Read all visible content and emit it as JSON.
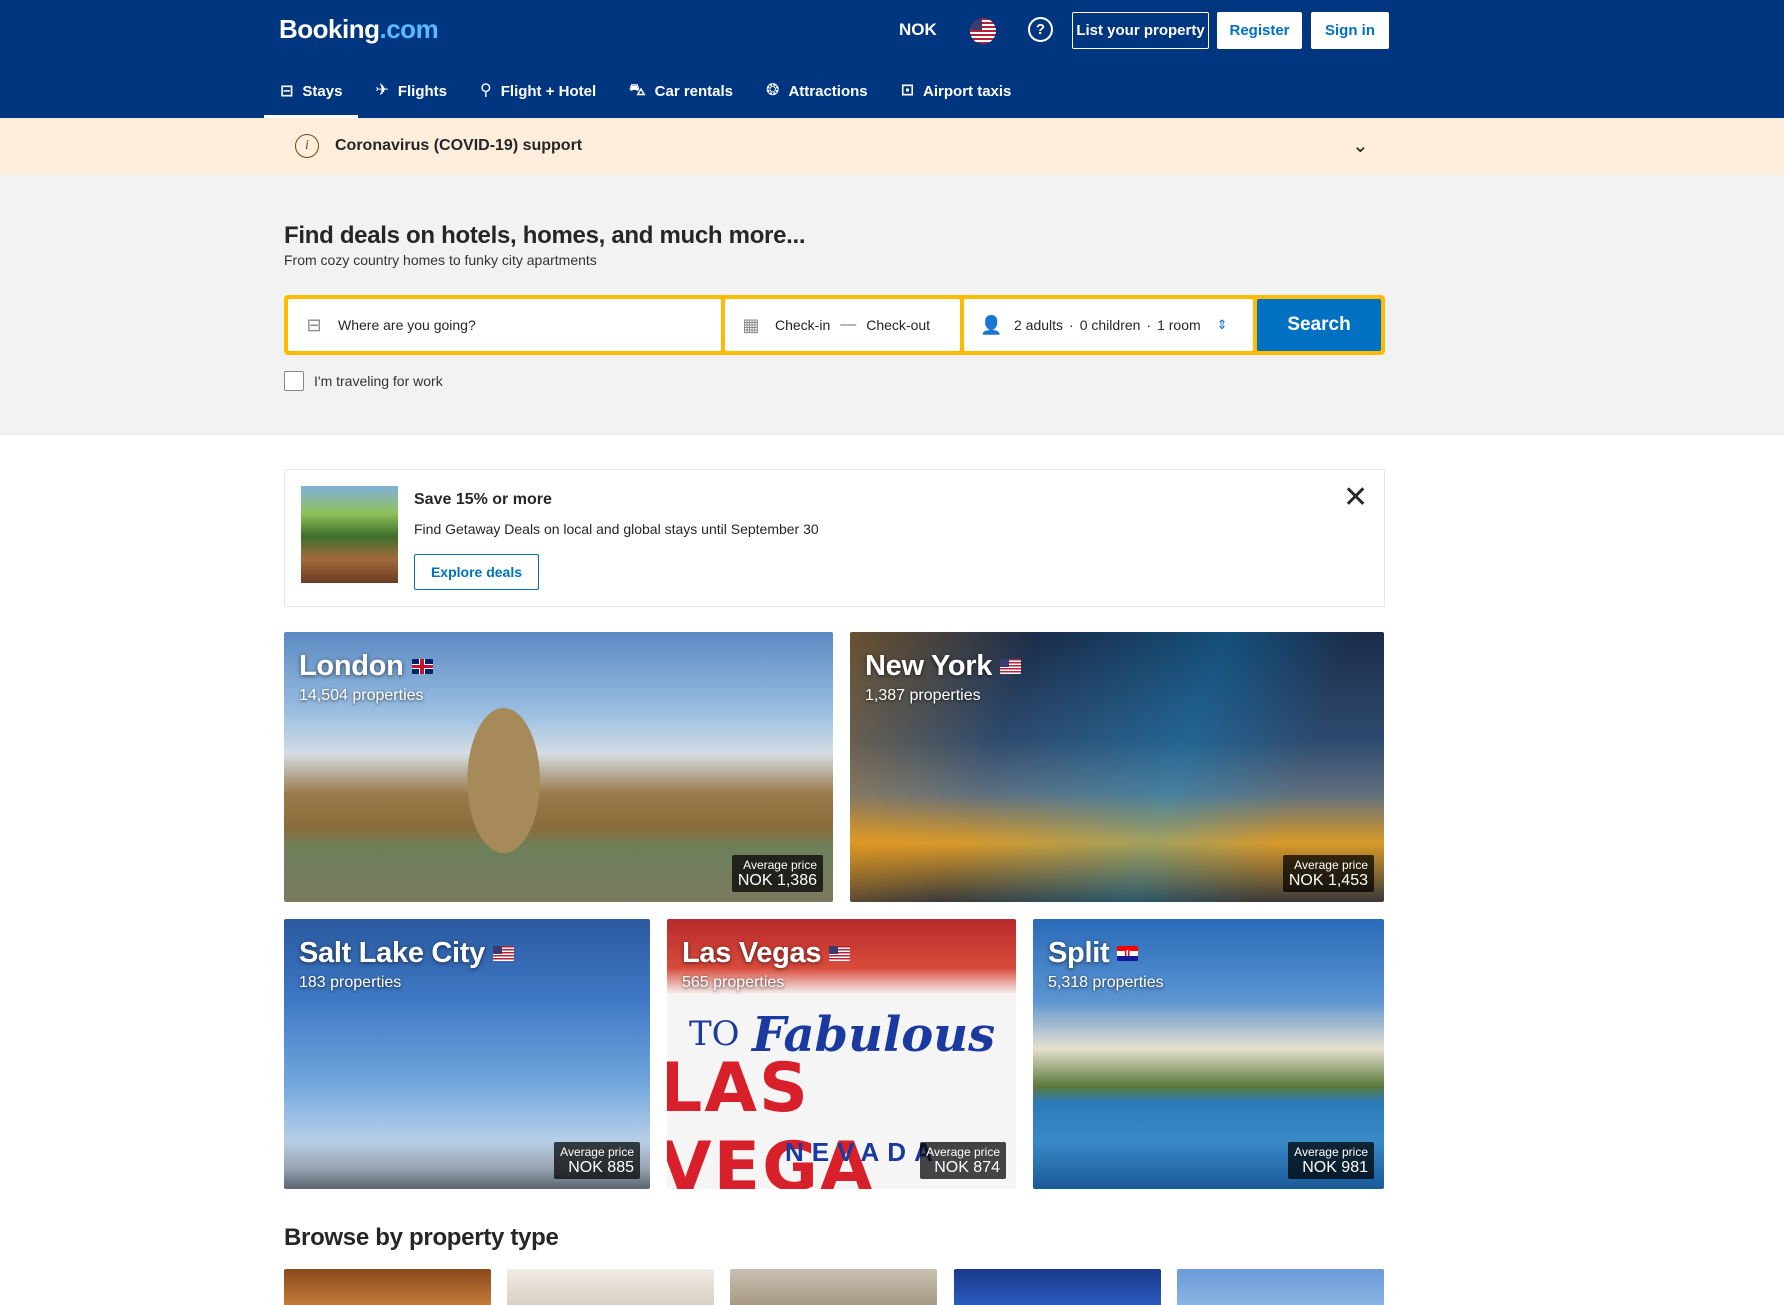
{
  "header": {
    "logo_main": "Booking",
    "logo_suffix": ".com",
    "currency": "NOK",
    "language_flag": "us-flag",
    "help_icon": "question-icon",
    "list_property": "List your property",
    "register": "Register",
    "sign_in": "Sign in"
  },
  "nav": {
    "items": [
      {
        "label": "Stays",
        "icon": "bed-icon",
        "glyph": "🛏"
      },
      {
        "label": "Flights",
        "icon": "plane-icon",
        "glyph": "✈"
      },
      {
        "label": "Flight + Hotel",
        "icon": "plane-bed-icon",
        "glyph": "⚲"
      },
      {
        "label": "Car rentals",
        "icon": "car-icon",
        "glyph": "🚗"
      },
      {
        "label": "Attractions",
        "icon": "ferris-wheel-icon",
        "glyph": "❂"
      },
      {
        "label": "Airport taxis",
        "icon": "taxi-icon",
        "glyph": "🚕"
      }
    ],
    "active": "Stays"
  },
  "covid_banner": {
    "text": "Coronavirus (COVID-19) support",
    "icon": "info-icon"
  },
  "hero": {
    "title": "Find deals on hotels, homes, and much more...",
    "subtitle": "From cozy country homes to funky city apartments"
  },
  "search": {
    "destination_placeholder": "Where are you going?",
    "check_in": "Check-in",
    "check_out": "Check-out",
    "adults": "2 adults",
    "children": "0 children",
    "rooms": "1 room",
    "separator": "·",
    "button": "Search",
    "work_label": "I'm traveling for work",
    "accent_color": "#febb02",
    "button_color": "#0071c2"
  },
  "promo": {
    "title": "Save 15% or more",
    "text": "Find Getaway Deals on local and global stays until September 30",
    "button": "Explore deals"
  },
  "destinations": [
    {
      "city": "London",
      "flag": "uk-flag",
      "properties": "14,504 properties",
      "price_label": "Average price",
      "price": "NOK 1,386"
    },
    {
      "city": "New York",
      "flag": "us-flag",
      "properties": "1,387 properties",
      "price_label": "Average price",
      "price": "NOK 1,453"
    },
    {
      "city": "Salt Lake City",
      "flag": "us-flag",
      "properties": "183 properties",
      "price_label": "Average price",
      "price": "NOK 885"
    },
    {
      "city": "Las Vegas",
      "flag": "us-flag",
      "properties": "565 properties",
      "price_label": "Average price",
      "price": "NOK 874"
    },
    {
      "city": "Split",
      "flag": "croatia-flag",
      "properties": "5,318 properties",
      "price_label": "Average price",
      "price": "NOK 981"
    }
  ],
  "browse": {
    "title": "Browse by property type"
  },
  "colors": {
    "header_bg": "#003580",
    "covid_bg": "#fdeedb",
    "link": "#0071c2"
  }
}
